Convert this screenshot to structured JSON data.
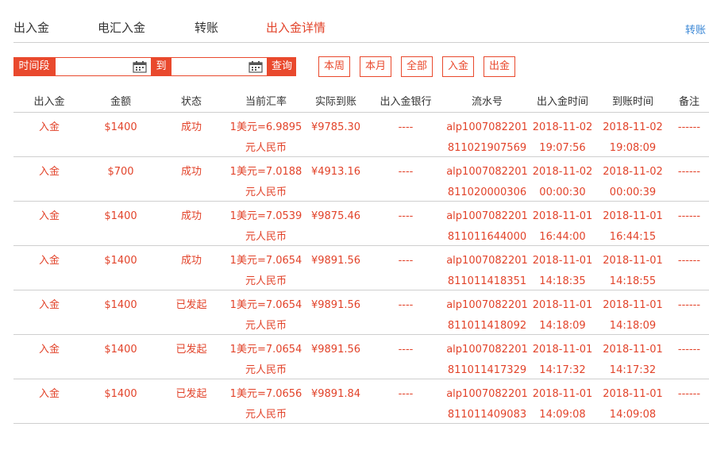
{
  "tabs": [
    {
      "label": "出入金"
    },
    {
      "label": "电汇入金"
    },
    {
      "label": "转账"
    },
    {
      "label": "出入金详情"
    },
    {
      "label": "转账"
    }
  ],
  "filter": {
    "period_label": "时间段",
    "to_label": "到",
    "query_label": "查询",
    "start_value": "",
    "end_value": "",
    "chips": [
      "本周",
      "本月",
      "全部",
      "入金",
      "出金"
    ]
  },
  "table": {
    "headers": [
      "出入金",
      "金额",
      "状态",
      "当前汇率",
      "实际到账",
      "出入金银行",
      "流水号",
      "出入金时间",
      "到账时间",
      "备注"
    ],
    "rows": [
      {
        "type": "入金",
        "amount": "$1400",
        "status": "成功",
        "rate": "1美元=6.9895",
        "rate_unit": "元人民币",
        "received": "¥9785.30",
        "bank": "----",
        "serial_1": "alp1007082201",
        "serial_2": "811021907569",
        "time_date": "2018-11-02",
        "time_clock": "19:07:56",
        "arrive_date": "2018-11-02",
        "arrive_clock": "19:08:09",
        "note": "------"
      },
      {
        "type": "入金",
        "amount": "$700",
        "status": "成功",
        "rate": "1美元=7.0188",
        "rate_unit": "元人民币",
        "received": "¥4913.16",
        "bank": "----",
        "serial_1": "alp1007082201",
        "serial_2": "811020000306",
        "time_date": "2018-11-02",
        "time_clock": "00:00:30",
        "arrive_date": "2018-11-02",
        "arrive_clock": "00:00:39",
        "note": "------"
      },
      {
        "type": "入金",
        "amount": "$1400",
        "status": "成功",
        "rate": "1美元=7.0539",
        "rate_unit": "元人民币",
        "received": "¥9875.46",
        "bank": "----",
        "serial_1": "alp1007082201",
        "serial_2": "811011644000",
        "time_date": "2018-11-01",
        "time_clock": "16:44:00",
        "arrive_date": "2018-11-01",
        "arrive_clock": "16:44:15",
        "note": "------"
      },
      {
        "type": "入金",
        "amount": "$1400",
        "status": "成功",
        "rate": "1美元=7.0654",
        "rate_unit": "元人民币",
        "received": "¥9891.56",
        "bank": "----",
        "serial_1": "alp1007082201",
        "serial_2": "811011418351",
        "time_date": "2018-11-01",
        "time_clock": "14:18:35",
        "arrive_date": "2018-11-01",
        "arrive_clock": "14:18:55",
        "note": "------"
      },
      {
        "type": "入金",
        "amount": "$1400",
        "status": "已发起",
        "rate": "1美元=7.0654",
        "rate_unit": "元人民币",
        "received": "¥9891.56",
        "bank": "----",
        "serial_1": "alp1007082201",
        "serial_2": "811011418092",
        "time_date": "2018-11-01",
        "time_clock": "14:18:09",
        "arrive_date": "2018-11-01",
        "arrive_clock": "14:18:09",
        "note": "------"
      },
      {
        "type": "入金",
        "amount": "$1400",
        "status": "已发起",
        "rate": "1美元=7.0654",
        "rate_unit": "元人民币",
        "received": "¥9891.56",
        "bank": "----",
        "serial_1": "alp1007082201",
        "serial_2": "811011417329",
        "time_date": "2018-11-01",
        "time_clock": "14:17:32",
        "arrive_date": "2018-11-01",
        "arrive_clock": "14:17:32",
        "note": "------"
      },
      {
        "type": "入金",
        "amount": "$1400",
        "status": "已发起",
        "rate": "1美元=7.0656",
        "rate_unit": "元人民币",
        "received": "¥9891.84",
        "bank": "----",
        "serial_1": "alp1007082201",
        "serial_2": "811011409083",
        "time_date": "2018-11-01",
        "time_clock": "14:09:08",
        "arrive_date": "2018-11-01",
        "arrive_clock": "14:09:08",
        "note": "------"
      }
    ]
  },
  "colors": {
    "accent": "#e9492d",
    "link": "#3a87d6",
    "text": "#333333",
    "rule": "#cfcfcf"
  },
  "icons": {
    "date_picker": "calendar-icon"
  }
}
